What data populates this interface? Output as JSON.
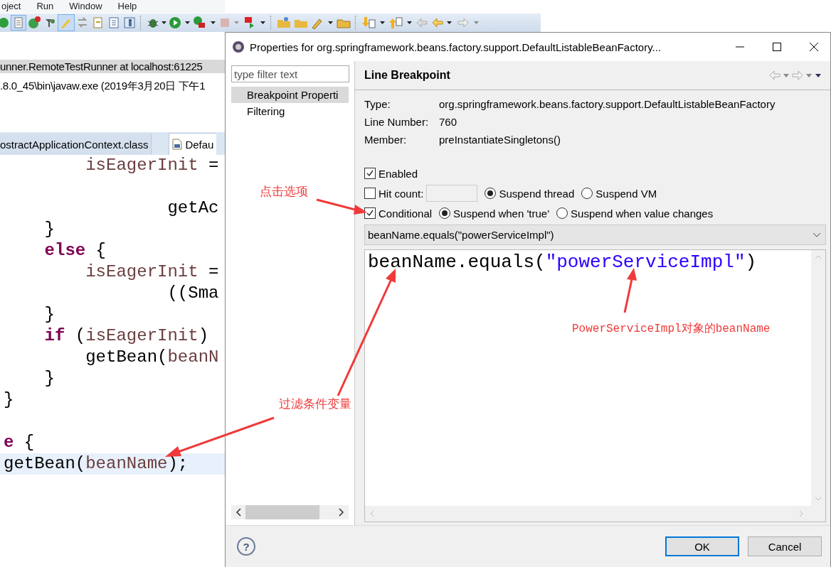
{
  "menu_bar": [
    "oject",
    "Run",
    "Window",
    "Help"
  ],
  "console": [
    {
      "text": "unner.RemoteTestRunner at localhost:61225",
      "selected": true
    },
    {
      "text": ".8.0_45\\bin\\javaw.exe (2019年3月20日 下午1",
      "selected": false
    }
  ],
  "editor_tabs": [
    {
      "label": "ostractApplicationContext.class",
      "selected": false
    },
    {
      "label": "Defau",
      "selected": true
    }
  ],
  "code_lines": [
    {
      "kind": "code",
      "highlighted": false,
      "tokens": [
        {
          "text": "        isEagerInit",
          "kind": "variable"
        },
        {
          "text": " =",
          "kind": "plain"
        }
      ]
    },
    {
      "kind": "blank",
      "highlighted": false
    },
    {
      "kind": "code",
      "highlighted": false,
      "tokens": [
        {
          "text": "                getAc",
          "kind": "plain"
        }
      ]
    },
    {
      "kind": "code",
      "highlighted": false,
      "tokens": [
        {
          "text": "    }",
          "kind": "plain"
        }
      ]
    },
    {
      "kind": "code",
      "highlighted": false,
      "tokens": [
        {
          "text": "    else",
          "kind": "keyword"
        },
        {
          "text": " {",
          "kind": "plain"
        }
      ]
    },
    {
      "kind": "code",
      "highlighted": false,
      "tokens": [
        {
          "text": "        isEagerInit",
          "kind": "variable"
        },
        {
          "text": " =",
          "kind": "plain"
        }
      ]
    },
    {
      "kind": "code",
      "highlighted": false,
      "tokens": [
        {
          "text": "                ((Sma",
          "kind": "plain"
        }
      ]
    },
    {
      "kind": "code",
      "highlighted": false,
      "tokens": [
        {
          "text": "    }",
          "kind": "plain"
        }
      ]
    },
    {
      "kind": "code",
      "highlighted": false,
      "tokens": [
        {
          "text": "    if",
          "kind": "keyword"
        },
        {
          "text": " (",
          "kind": "plain"
        },
        {
          "text": "isEagerInit",
          "kind": "variable"
        },
        {
          "text": ")",
          "kind": "plain"
        }
      ]
    },
    {
      "kind": "code",
      "highlighted": false,
      "tokens": [
        {
          "text": "        getBean(",
          "kind": "plain"
        },
        {
          "text": "beanN",
          "kind": "variable"
        }
      ]
    },
    {
      "kind": "code",
      "highlighted": false,
      "tokens": [
        {
          "text": "    }",
          "kind": "plain"
        }
      ]
    },
    {
      "kind": "code",
      "highlighted": false,
      "tokens": [
        {
          "text": "}",
          "kind": "plain"
        }
      ]
    },
    {
      "kind": "blank",
      "highlighted": false
    },
    {
      "kind": "code",
      "highlighted": false,
      "tokens": [
        {
          "text": "e",
          "kind": "keyword"
        },
        {
          "text": " {",
          "kind": "plain"
        }
      ]
    },
    {
      "kind": "code",
      "highlighted": true,
      "tokens": [
        {
          "text": "getBean(",
          "kind": "plain"
        },
        {
          "text": "beanName",
          "kind": "variable"
        },
        {
          "text": ");",
          "kind": "plain"
        }
      ]
    }
  ],
  "dialog": {
    "title": "Properties for org.springframework.beans.factory.support.DefaultListableBeanFactory...",
    "filter": {
      "placeholder": "type filter text"
    },
    "pages": [
      {
        "label": "Breakpoint Properti",
        "selected": true
      },
      {
        "label": "Filtering",
        "selected": false
      }
    ],
    "heading": "Line Breakpoint",
    "info": [
      {
        "label": "Type:",
        "value": "org.springframework.beans.factory.support.DefaultListableBeanFactory"
      },
      {
        "label": "Line Number:",
        "value": "760"
      },
      {
        "label": "Member:",
        "value": "preInstantiateSingletons()"
      }
    ],
    "enabled": {
      "label": "Enabled",
      "checked": true
    },
    "hit_count": {
      "label": "Hit count:",
      "checked": false
    },
    "suspend_policy": [
      {
        "label": "Suspend thread",
        "selected": true
      },
      {
        "label": "Suspend VM",
        "selected": false
      }
    ],
    "conditional": {
      "label": "Conditional",
      "checked": true
    },
    "suspend_when": [
      {
        "label": "Suspend when 'true'",
        "selected": true
      },
      {
        "label": "Suspend when value changes",
        "selected": false
      }
    ],
    "condition_history": "beanName.equals(\"powerServiceImpl\")",
    "condition": [
      {
        "text": "beanName.equals(",
        "kind": "plain"
      },
      {
        "text": "\"powerServiceImpl\"",
        "kind": "string"
      },
      {
        "text": ")",
        "kind": "plain"
      }
    ],
    "help": "?",
    "buttons": [
      {
        "label": "OK",
        "default": true
      },
      {
        "label": "Cancel",
        "default": false
      }
    ]
  },
  "annotations": [
    {
      "text": "点击选项"
    },
    {
      "text": "过滤条件变量"
    },
    {
      "text": "PowerServiceImpl对象的beanName"
    }
  ]
}
